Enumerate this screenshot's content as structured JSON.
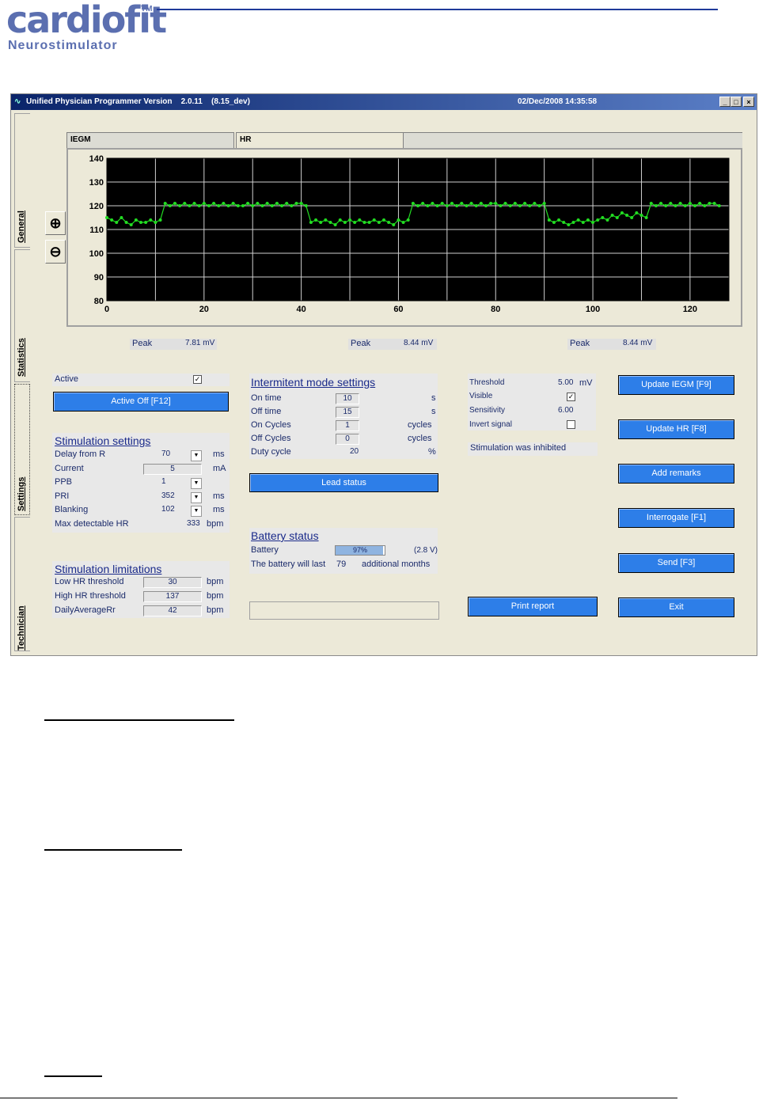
{
  "brand": {
    "logo": "cardiofit",
    "tm": "TM",
    "subtitle": "Neurostimulator"
  },
  "window": {
    "title": "Unified Physician Programmer Version    2.0.11    (8.15_dev)",
    "datetime": "02/Dec/2008 14:35:58",
    "controls": {
      "minimize": "_",
      "maximize": "□",
      "close": "×"
    }
  },
  "side_tabs": [
    "General",
    "Statistics",
    "Settings",
    "Technician"
  ],
  "chart_tabs": [
    "IEGM",
    "HR"
  ],
  "zoom": {
    "in": "⊕",
    "out": "⊖"
  },
  "chart_data": {
    "type": "line",
    "xlim": [
      0,
      128
    ],
    "ylim": [
      80,
      140
    ],
    "x_ticks": [
      0,
      20,
      40,
      60,
      80,
      100,
      120
    ],
    "y_ticks": [
      80,
      90,
      100,
      110,
      120,
      130,
      140
    ],
    "grid": true,
    "line_color": "#22dd22",
    "background": "#000000",
    "series": [
      {
        "x": [
          0,
          1,
          2,
          3,
          4,
          5,
          6,
          7,
          8,
          9,
          10,
          11,
          12,
          13,
          14,
          15,
          16,
          17,
          18,
          19,
          20,
          21,
          22,
          23,
          24,
          25,
          26,
          27,
          28,
          29,
          30,
          31,
          32,
          33,
          34,
          35,
          36,
          37,
          38,
          39,
          40,
          41,
          42,
          43,
          44,
          45,
          46,
          47,
          48,
          49,
          50,
          51,
          52,
          53,
          54,
          55,
          56,
          57,
          58,
          59,
          60,
          61,
          62,
          63,
          64,
          65,
          66,
          67,
          68,
          69,
          70,
          71,
          72,
          73,
          74,
          75,
          76,
          77,
          78,
          79,
          80,
          81,
          82,
          83,
          84,
          85,
          86,
          87,
          88,
          89,
          90,
          91,
          92,
          93,
          94,
          95,
          96,
          97,
          98,
          99,
          100,
          101,
          102,
          103,
          104,
          105,
          106,
          107,
          108,
          109,
          110,
          111,
          112,
          113,
          114,
          115,
          116,
          117,
          118,
          119,
          120,
          121,
          122,
          123,
          124,
          125,
          126
        ],
        "y": [
          115,
          114,
          113,
          115,
          113,
          112,
          114,
          113,
          113,
          114,
          113,
          114,
          121,
          120,
          121,
          120,
          121,
          120,
          121,
          120,
          121,
          120,
          121,
          120,
          121,
          120,
          121,
          120,
          120,
          121,
          120,
          121,
          120,
          121,
          120,
          121,
          120,
          121,
          120,
          121,
          121,
          120,
          113,
          114,
          113,
          114,
          113,
          112,
          114,
          113,
          114,
          113,
          114,
          113,
          113,
          114,
          113,
          114,
          113,
          112,
          114,
          113,
          114,
          121,
          120,
          121,
          120,
          121,
          120,
          121,
          120,
          121,
          120,
          121,
          120,
          121,
          120,
          121,
          120,
          121,
          121,
          120,
          121,
          120,
          121,
          120,
          121,
          120,
          121,
          120,
          121,
          114,
          113,
          114,
          113,
          112,
          113,
          114,
          113,
          114,
          113,
          114,
          115,
          114,
          116,
          115,
          117,
          116,
          115,
          117,
          116,
          115,
          121,
          120,
          121,
          120,
          121,
          120,
          121,
          120,
          121,
          120,
          121,
          120,
          121,
          121,
          120
        ]
      }
    ]
  },
  "peaks": [
    {
      "label": "Peak",
      "value": "7.81 mV"
    },
    {
      "label": "Peak",
      "value": "8.44 mV"
    },
    {
      "label": "Peak",
      "value": "8.44 mV"
    }
  ],
  "active": {
    "label": "Active",
    "checked": "✓",
    "button": "Active Off  [F12]"
  },
  "stimulation_settings": {
    "heading": "Stimulation settings",
    "rows": [
      {
        "label": "Delay from R",
        "value": "70",
        "unit": "ms"
      },
      {
        "label": "Current",
        "value": "5",
        "unit": "mA"
      },
      {
        "label": "PPB",
        "value": "1",
        "unit": ""
      },
      {
        "label": "PRI",
        "value": "352",
        "unit": "ms"
      },
      {
        "label": "Blanking",
        "value": "102",
        "unit": "ms"
      },
      {
        "label": "Max detectable HR",
        "value": "333",
        "unit": "bpm"
      }
    ]
  },
  "stimulation_limitations": {
    "heading": "Stimulation limitations",
    "rows": [
      {
        "label": "Low HR threshold",
        "value": "30",
        "unit": "bpm"
      },
      {
        "label": "High HR threshold",
        "value": "137",
        "unit": "bpm"
      },
      {
        "label": "DailyAverageRr",
        "value": "42",
        "unit": "bpm"
      }
    ]
  },
  "intermittent": {
    "heading": "Intermitent mode settings",
    "rows": [
      {
        "label": "On time",
        "value": "10",
        "unit": "s"
      },
      {
        "label": "Off time",
        "value": "15",
        "unit": "s"
      },
      {
        "label": "On Cycles",
        "value": "1",
        "unit": "cycles"
      },
      {
        "label": "Off Cycles",
        "value": "0",
        "unit": "cycles"
      },
      {
        "label": "Duty cycle",
        "value": "20",
        "unit": "%"
      }
    ],
    "lead_status": "Lead status"
  },
  "battery": {
    "heading": "Battery status",
    "label": "Battery",
    "percent_text": "97%",
    "level": 0.97,
    "voltage": "(2.8 V)",
    "last_prefix": "The battery will last",
    "months": "79",
    "last_suffix": "additional months"
  },
  "signal": {
    "threshold_label": "Threshold",
    "threshold_value": "5.00",
    "threshold_unit": "mV",
    "visible_label": "Visible",
    "visible_checked": "✓",
    "sensitivity_label": "Sensitivity",
    "sensitivity_value": "6.00",
    "invert_label": "Invert signal",
    "inhibited": "Stimulation was inhibited"
  },
  "buttons": {
    "update_iegm": "Update IEGM [F9]",
    "update_hr": "Update HR [F8]",
    "add_remarks": "Add remarks",
    "interrogate": "Interrogate  [F1]",
    "send": "Send  [F3]",
    "print_report": "Print report",
    "exit": "Exit"
  }
}
